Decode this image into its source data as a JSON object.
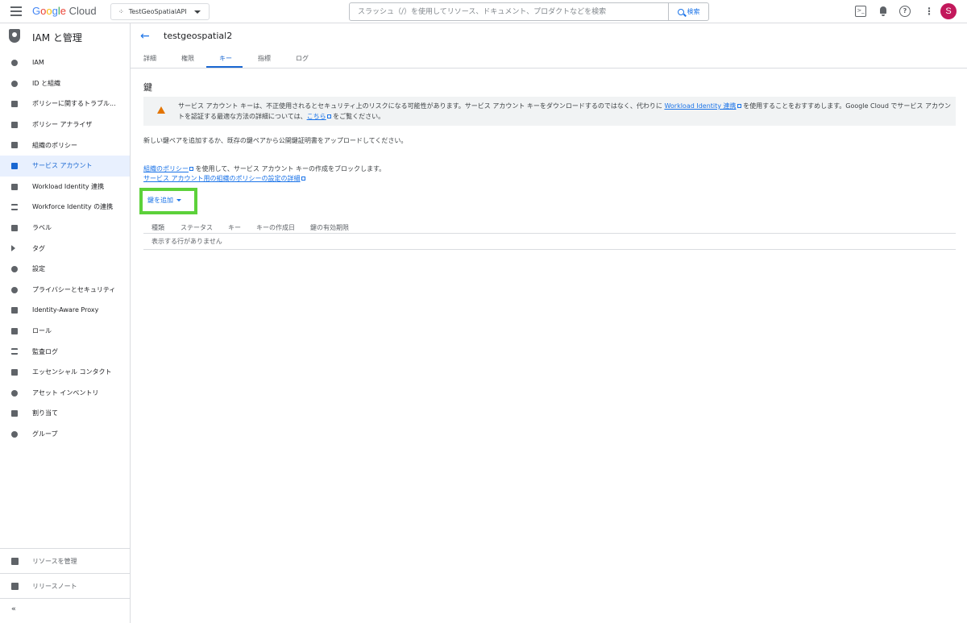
{
  "topbar": {
    "brand": {
      "g": "G",
      "o1": "o",
      "o2": "o",
      "g2": "g",
      "l": "l",
      "e": "e",
      "cloud": "Cloud"
    },
    "project": "TestGeoSpatialAPI",
    "search_placeholder": "スラッシュ（/）を使用してリソース、ドキュメント、プロダクトなどを検索",
    "search_button": "検索",
    "avatar_letter": "S"
  },
  "sidebar": {
    "title": "IAM と管理",
    "items": [
      {
        "label": "IAM"
      },
      {
        "label": "ID と組織"
      },
      {
        "label": "ポリシーに関するトラブル..."
      },
      {
        "label": "ポリシー アナライザ"
      },
      {
        "label": "組織のポリシー"
      },
      {
        "label": "サービス アカウント"
      },
      {
        "label": "Workload Identity 連携"
      },
      {
        "label": "Workforce Identity の連携"
      },
      {
        "label": "ラベル"
      },
      {
        "label": "タグ"
      },
      {
        "label": "設定"
      },
      {
        "label": "プライバシーとセキュリティ"
      },
      {
        "label": "Identity-Aware Proxy"
      },
      {
        "label": "ロール"
      },
      {
        "label": "監査ログ"
      },
      {
        "label": "エッセンシャル コンタクト"
      },
      {
        "label": "アセット インベントリ"
      },
      {
        "label": "割り当て"
      },
      {
        "label": "グループ"
      }
    ],
    "manage_resources": "リソースを管理",
    "release_notes": "リリースノート",
    "collapse": "«"
  },
  "main": {
    "title": "testgeospatial2",
    "tabs": [
      {
        "label": "詳細"
      },
      {
        "label": "権限"
      },
      {
        "label": "キー"
      },
      {
        "label": "指標"
      },
      {
        "label": "ログ"
      }
    ],
    "section_title": "鍵",
    "warning": {
      "part1": "サービス アカウント キーは、不正使用されるとセキュリティ上のリスクになる可能性があります。サービス アカウント キーをダウンロードするのではなく、代わりに ",
      "link1": "Workload Identity 連携",
      "part2": " を使用することをおすすめします。Google Cloud でサービス アカウントを認証する最適な方法の詳細については、",
      "link2": "こちら",
      "part3": " をご覧ください。"
    },
    "description": "新しい鍵ペアを追加するか、既存の鍵ペアから公開鍵証明書をアップロードしてください。",
    "policy_link": "組織のポリシー",
    "policy_text": " を使用して、サービス アカウント キーの作成をブロックします。",
    "policy_detail_link": "サービス アカウント用の組織のポリシーの設定の詳細",
    "add_key_button": "鍵を追加",
    "table": {
      "columns": [
        "種類",
        "ステータス",
        "キー",
        "キーの作成日",
        "鍵の有効期限"
      ],
      "empty_text": "表示する行がありません"
    }
  },
  "colors": {
    "accent": "#1a73e8",
    "highlight": "#5cd13a",
    "warning": "#e37400",
    "avatar": "#c2185b"
  }
}
